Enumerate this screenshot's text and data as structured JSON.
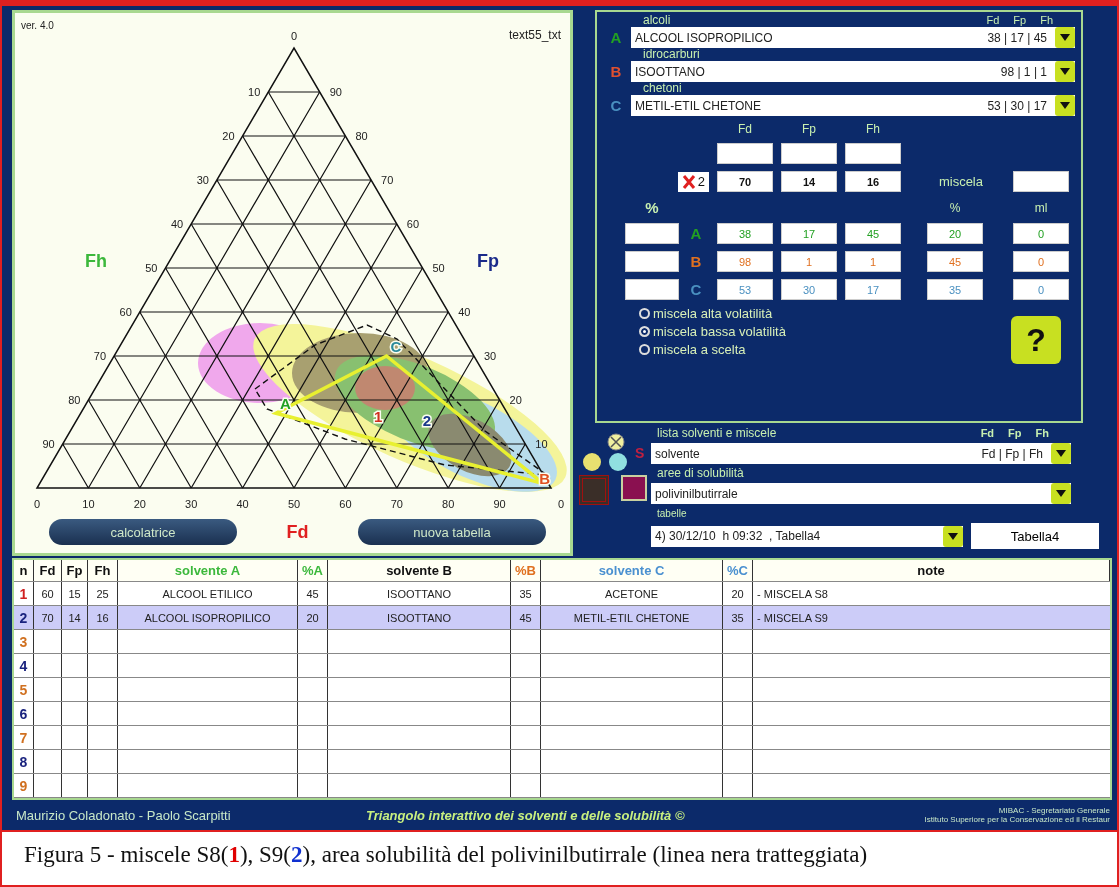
{
  "left_panel": {
    "version": "ver. 4.0",
    "corner_text": "text55_txt",
    "diagram": {
      "apex_tick": "0",
      "left_ticks": [
        "10",
        "20",
        "30",
        "40",
        "50",
        "60",
        "70",
        "80",
        "90"
      ],
      "right_ticks": [
        "90",
        "80",
        "70",
        "60",
        "50",
        "40",
        "30",
        "20",
        "10"
      ],
      "bottom_ticks": [
        "0",
        "10",
        "20",
        "30",
        "40",
        "50",
        "60",
        "70",
        "80",
        "90"
      ],
      "corner_tick": "0",
      "left_axis": {
        "label": "Fh",
        "color": "#3cb83c"
      },
      "right_axis": {
        "label": "Fp",
        "color": "#1a2a8a"
      },
      "solvent_points": [
        {
          "label": "A",
          "color": "#22a022"
        },
        {
          "label": "B",
          "color": "#e05020"
        },
        {
          "label": "C",
          "color": "#2a8a9a"
        }
      ],
      "mixture_points": [
        {
          "label": "1",
          "color": "#d03020"
        },
        {
          "label": "2",
          "color": "#1a3a8a"
        }
      ]
    },
    "bottom_axis": {
      "label": "Fd",
      "color": "#e02020"
    },
    "buttons": [
      "calcolatrice",
      "nuova tabella"
    ]
  },
  "solvent_selectors": [
    {
      "category": "alcoli",
      "letter": "A",
      "color": "#22a022",
      "name": "ALCOOL ISOPROPILICO",
      "values": "38 | 17 | 45"
    },
    {
      "category": "idrocarburi",
      "letter": "B",
      "color": "#e05030",
      "name": "ISOOTTANO",
      "values": "98 | 1 | 1"
    },
    {
      "category": "chetoni",
      "letter": "C",
      "color": "#4a90c0",
      "name": "METIL-ETIL CHETONE",
      "values": "53 | 30 | 17"
    }
  ],
  "selector_headers": [
    "Fd",
    "Fp",
    "Fh"
  ],
  "calculator": {
    "headers": [
      "Fd",
      "Fp",
      "Fh"
    ],
    "result_count": "2",
    "result": [
      "70",
      "14",
      "16"
    ],
    "mix_label": "miscela",
    "percent_label": "%",
    "mix_headers": [
      "%",
      "ml"
    ],
    "rows": [
      {
        "letter": "A",
        "color": "#22a022",
        "values": [
          "38",
          "17",
          "45"
        ],
        "percent": "20",
        "ml": "0"
      },
      {
        "letter": "B",
        "color": "#e07020",
        "values": [
          "98",
          "1",
          "1"
        ],
        "percent": "45",
        "ml": "0"
      },
      {
        "letter": "C",
        "color": "#4a90c0",
        "values": [
          "53",
          "30",
          "17"
        ],
        "percent": "35",
        "ml": "0"
      }
    ]
  },
  "radios": [
    {
      "label": "miscela alta volatilità",
      "selected": false
    },
    {
      "label": "miscela bassa volatilità",
      "selected": true
    },
    {
      "label": "miscela a scelta",
      "selected": false
    }
  ],
  "help_button": "?",
  "marker_letter": "S",
  "solvent_list": {
    "label": "lista solventi e miscele",
    "headers": [
      "Fd",
      "Fp",
      "Fh"
    ],
    "value": "solvente",
    "values": "Fd | Fp | Fh"
  },
  "swatches": [
    {
      "color": "#3a2e28",
      "selected": true
    },
    {
      "color": "#8a1050",
      "selected": false
    }
  ],
  "solubility_areas": {
    "label": "aree di solubilità",
    "value": "polivinilbutirrale"
  },
  "tables": {
    "label": "tabelle",
    "value": "4) 30/12/10  h 09:32  , Tabella4",
    "name": "Tabella4"
  },
  "table": {
    "columns": [
      {
        "label": "n",
        "color": "#111111"
      },
      {
        "label": "Fd",
        "color": "#111111"
      },
      {
        "label": "Fp",
        "color": "#111111"
      },
      {
        "label": "Fh",
        "color": "#111111"
      },
      {
        "label": "solvente A",
        "color": "#3cb83c"
      },
      {
        "label": "%A",
        "color": "#3cb83c"
      },
      {
        "label": "solvente B",
        "color": "#111111"
      },
      {
        "label": "%B",
        "color": "#e07020"
      },
      {
        "label": "solvente C",
        "color": "#4a90d0"
      },
      {
        "label": "%C",
        "color": "#4a90d0"
      },
      {
        "label": "note",
        "color": "#111111"
      }
    ],
    "rows": [
      {
        "color": "#d02020",
        "selected": false,
        "cells": [
          "1",
          "60",
          "15",
          "25",
          "ALCOOL ETILICO",
          "45",
          "ISOOTTANO",
          "35",
          "ACETONE",
          "20",
          "- MISCELA S8"
        ]
      },
      {
        "color": "#1a237e",
        "selected": true,
        "cells": [
          "2",
          "70",
          "14",
          "16",
          "ALCOOL ISOPROPILICO",
          "20",
          "ISOOTTANO",
          "45",
          "METIL-ETIL CHETONE",
          "35",
          "- MISCELA S9"
        ]
      },
      {
        "color": "#d07020",
        "selected": false,
        "cells": [
          "3"
        ]
      },
      {
        "color": "#1a237e",
        "selected": false,
        "cells": [
          "4"
        ]
      },
      {
        "color": "#d07020",
        "selected": false,
        "cells": [
          "5"
        ]
      },
      {
        "color": "#1a237e",
        "selected": false,
        "cells": [
          "6"
        ]
      },
      {
        "color": "#d07020",
        "selected": false,
        "cells": [
          "7"
        ]
      },
      {
        "color": "#1a237e",
        "selected": false,
        "cells": [
          "8"
        ]
      },
      {
        "color": "#d07020",
        "selected": false,
        "cells": [
          "9"
        ]
      }
    ]
  },
  "footer": {
    "authors": "Maurizio Coladonato - Paolo Scarpitti",
    "title": "Triangolo interattivo dei solventi e delle solubilità ©",
    "org": [
      "MIBAC - Segretariato Generale",
      "Istituto Superiore per la Conservazione ed il Restaur"
    ]
  },
  "caption": [
    {
      "text": "Figura 5 - miscele S8("
    },
    {
      "text": "1",
      "color": "#e00000"
    },
    {
      "text": "), S9("
    },
    {
      "text": "2",
      "color": "#1030d0"
    },
    {
      "text": "), area solubilità del polivinilbutirrale (linea nera tratteggiata)"
    }
  ]
}
